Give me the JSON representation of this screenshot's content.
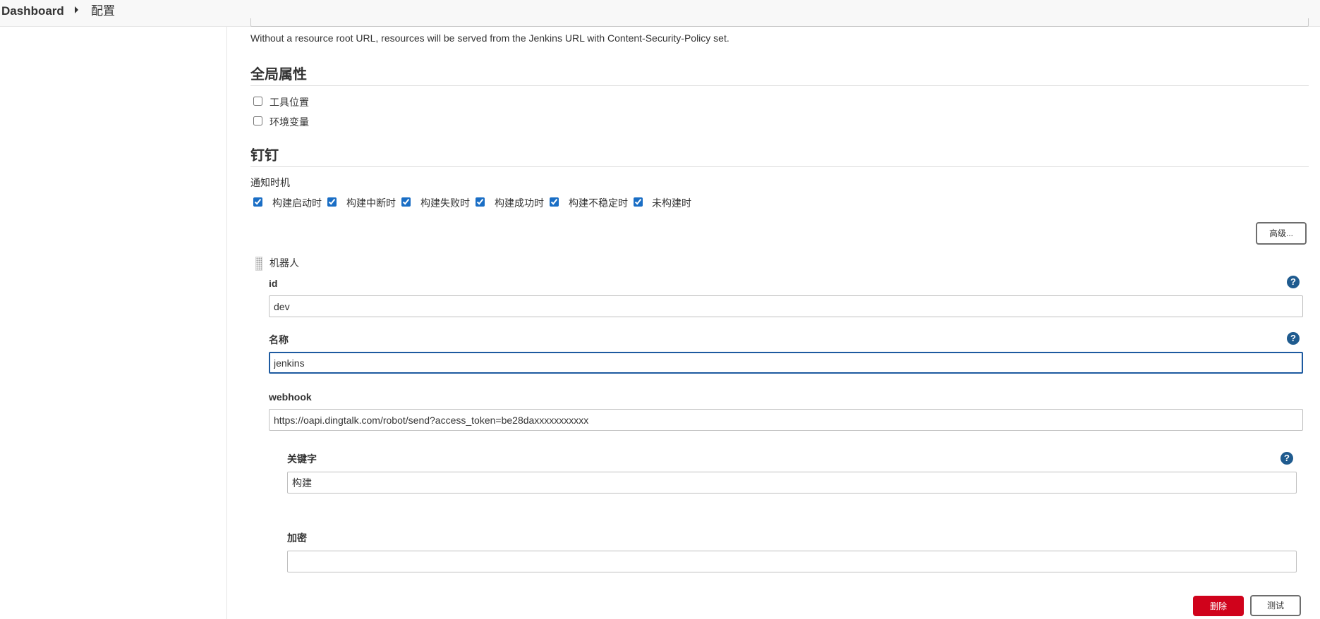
{
  "breadcrumb": {
    "home": "Dashboard",
    "current": "配置"
  },
  "resource_root": {
    "help": "Without a resource root URL, resources will be served from the Jenkins URL with Content-Security-Policy set."
  },
  "global_properties": {
    "title": "全局属性",
    "options": [
      {
        "label": "工具位置",
        "checked": false
      },
      {
        "label": "环境变量",
        "checked": false
      }
    ]
  },
  "dingtalk": {
    "title": "钉钉",
    "notify_label": "通知时机",
    "notify_options": [
      {
        "label": "构建启动时",
        "checked": true
      },
      {
        "label": "构建中断时",
        "checked": true
      },
      {
        "label": "构建失败时",
        "checked": true
      },
      {
        "label": "构建成功时",
        "checked": true
      },
      {
        "label": "构建不稳定时",
        "checked": true
      },
      {
        "label": "未构建时",
        "checked": true
      }
    ],
    "advanced_label": "高级...",
    "robot": {
      "header": "机器人",
      "id_label": "id",
      "id_value": "dev",
      "name_label": "名称",
      "name_value": "jenkins",
      "webhook_label": "webhook",
      "webhook_value": "https://oapi.dingtalk.com/robot/send?access_token=be28daxxxxxxxxxxx",
      "keyword_label": "关键字",
      "keyword_value": "构建",
      "secret_label": "加密",
      "secret_value": "",
      "delete_label": "删除",
      "test_label": "测试"
    }
  },
  "help_glyph": "?",
  "colors": {
    "accent": "#1d5aa0",
    "danger": "#d0021b",
    "help": "#1f5b8f"
  }
}
